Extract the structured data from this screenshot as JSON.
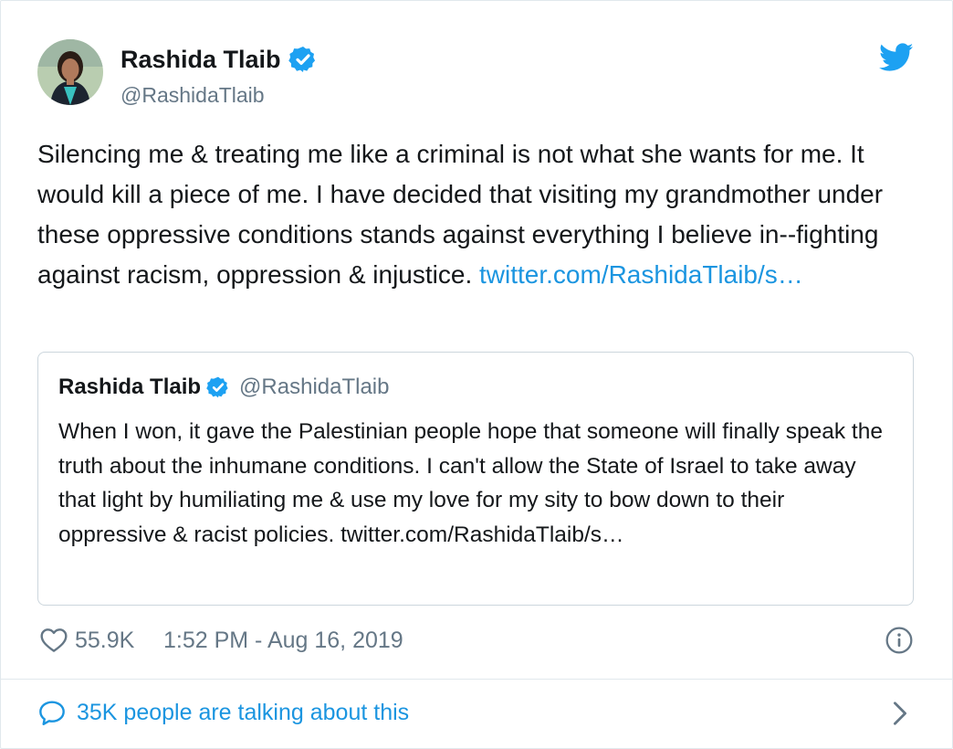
{
  "tweet": {
    "author": {
      "name": "Rashida Tlaib",
      "handle": "@RashidaTlaib",
      "verified": true
    },
    "text": "Silencing me & treating me like a criminal is not what she wants for me. It would kill a piece of me. I have decided that visiting my grandmother under these oppressive conditions stands against everything I believe in--fighting against racism, oppression & injustice. ",
    "link_text": "twitter.com/RashidaTlaib/s…",
    "quoted": {
      "name": "Rashida Tlaib",
      "handle": "@RashidaTlaib",
      "text": "When I won, it gave the Palestinian people hope that someone will finally speak the truth about the inhumane conditions. I can't allow the State of Israel to take away that light by humiliating me & use my love for my sity to bow down to their oppressive & racist policies. ",
      "link_text": "twitter.com/RashidaTlaib/s…"
    },
    "likes": "55.9K",
    "timestamp": "1:52 PM - Aug 16, 2019",
    "conversation": "35K people are talking about this"
  },
  "icons": {
    "brand": "twitter-bird-icon",
    "verified": "verified-badge-icon",
    "like": "heart-icon",
    "info": "info-icon",
    "reply": "speech-bubble-icon",
    "more": "chevron-right-icon"
  },
  "colors": {
    "text": "#14171a",
    "secondary": "#657786",
    "link": "#1b95e0",
    "verified": "#1da1f2",
    "border": "#e1e8ed"
  }
}
